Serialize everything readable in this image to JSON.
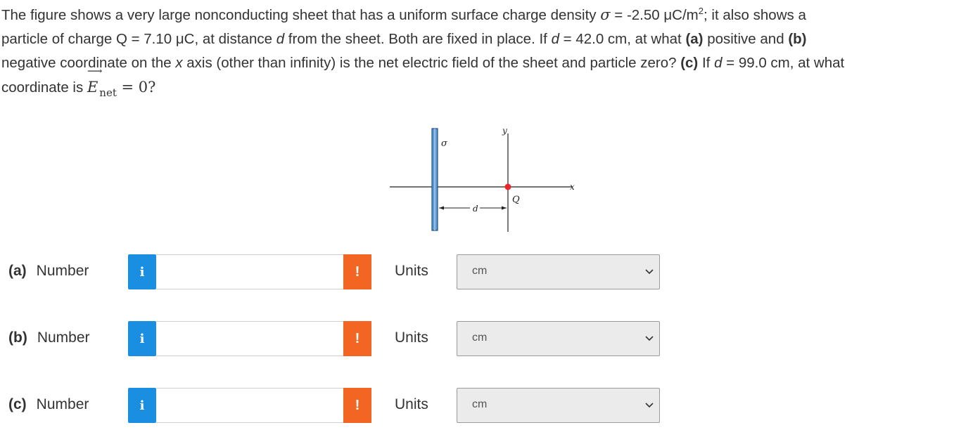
{
  "question": {
    "line1_a": "The figure shows a very large nonconducting sheet that has a uniform surface charge density ",
    "sigma_symbol": "σ",
    "line1_b": " = -2.50 μC/m",
    "line1_sup": "2",
    "line1_c": "; it also shows a",
    "line2_a": "particle of charge Q = 7.10 μC, at distance ",
    "d_symbol": "d",
    "line2_b": " from the sheet. Both are fixed in place. If ",
    "line2_c": " = 42.0 cm, at what ",
    "part_a": "(a)",
    "line2_d": " positive and ",
    "part_b": "(b)",
    "line3_a": "negative coordinate on the ",
    "x_symbol": "x",
    "line3_b": " axis (other than infinity) is the net electric field of the sheet and particle zero? ",
    "part_c": "(c)",
    "line3_c": " If ",
    "line3_d": " = 99.0 cm, at what",
    "line4_a": "coordinate is ",
    "E_symbol": "E",
    "arrow": "⟶",
    "net_sub": "net",
    "line4_b": " = 0?"
  },
  "figure": {
    "sigma_label": "σ",
    "y_label": "y",
    "x_label": "x",
    "d_label": "d",
    "q_label": "Q",
    "colors": {
      "sheet": "#5b9bd5",
      "sheet_edge": "#1f4e79",
      "charge": "#e8262b"
    }
  },
  "rows": [
    {
      "part": "(a)",
      "label": "Number",
      "info": "i",
      "warn": "!",
      "units_label": "Units",
      "value": "",
      "unit": "cm"
    },
    {
      "part": "(b)",
      "label": "Number",
      "info": "i",
      "warn": "!",
      "units_label": "Units",
      "value": "",
      "unit": "cm"
    },
    {
      "part": "(c)",
      "label": "Number",
      "info": "i",
      "warn": "!",
      "units_label": "Units",
      "value": "",
      "unit": "cm"
    }
  ]
}
